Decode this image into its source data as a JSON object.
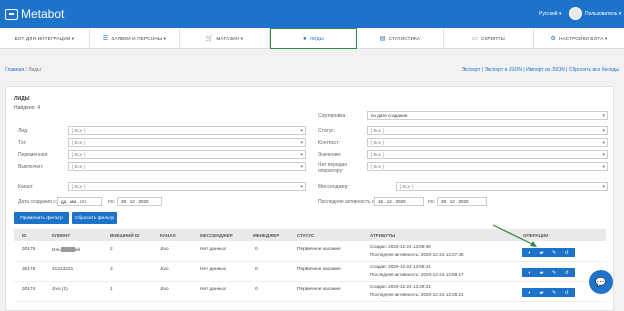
{
  "app": {
    "brand": "Metabot",
    "language": "Русский",
    "user": "Пользователь"
  },
  "nav": [
    {
      "label": "БОТ ДЛЯ ИНТЕГРАЦИИ",
      "icon": "chevron-down-icon"
    },
    {
      "label": "ЗАЯВКИ И ПЕРСОНЫ",
      "icon": "list-icon"
    },
    {
      "label": "МАГАЗИН",
      "icon": "cart-icon"
    },
    {
      "label": "ЛИДЫ",
      "icon": "person-icon"
    },
    {
      "label": "СТАТИСТИКА",
      "icon": "stats-icon"
    },
    {
      "label": "СКРИПТЫ",
      "icon": "script-icon"
    },
    {
      "label": "НАСТРОЙКИ БОТА",
      "icon": "gear-icon"
    }
  ],
  "breadcrumb": {
    "home": "Главная",
    "sep": "/",
    "current": "Лиды"
  },
  "top_links": "Экспорт | Экспорт в JSON | Импорт из JSON | Сбросить все беседы",
  "panel": {
    "title": "ЛИДЫ",
    "found": "Найдено: 4"
  },
  "filters": {
    "sort_label": "Сортировка:",
    "sort_value": "по дате создания",
    "lead": "Лид:",
    "tag": "Тэг:",
    "variable": "Переменная:",
    "off": "Выключен:",
    "status": "Статус:",
    "context": "Контекст:",
    "value": "Значение:",
    "operator": "Чат передан оператору:",
    "all": "[ Все ]",
    "channel": "Канал:",
    "messenger": "Мессенджер:",
    "created_label": "Дата создания с:",
    "created_from": "дд . мм . гггг",
    "created_to_label": "по:",
    "created_to": "28 . 12 . 2020",
    "activity_label": "Последняя активность с:",
    "activity_from": "16 . 12 . 2020",
    "activity_to_label": "по:",
    "activity_to": "28 . 12 . 2020"
  },
  "buttons": {
    "apply": "Применить фильтр",
    "reset": "Сбросить фильтр"
  },
  "table": {
    "headers": [
      "ID",
      "КЛИЕНТ",
      "ВНЕШНИЙ ID",
      "КАНАЛ",
      "МЕССЕНДЖЕР",
      "МЕНЕДЖЕР",
      "СТАТУС",
      "АТРИБУТЫ",
      "ОПЕРАЦИИ"
    ],
    "rows": [
      {
        "id": "30176",
        "client": "Иль",
        "client_tail": "ей",
        "ext": "2",
        "channel": "Jivo",
        "messenger": "Нет данных",
        "manager": "0",
        "status": "Первичное касание",
        "created": "Создан: 2020-12-24 13:59:48",
        "activity": "Последняя активность: 2020-12-24 14:27:45"
      },
      {
        "id": "30175",
        "client": "21213221",
        "ext": "3",
        "channel": "Jivo",
        "messenger": "Нет данных",
        "manager": "0",
        "status": "Первичное касание",
        "created": "Создан: 2020-12-24 13:58:41",
        "activity": "Последняя активность: 2020-12-24 13:59:17"
      },
      {
        "id": "30174",
        "client": "Jivo (1)",
        "ext": "1",
        "channel": "Jivo",
        "messenger": "Нет данных",
        "manager": "0",
        "status": "Первичное касание",
        "created": "Создан: 2020-12-24 13:28:21",
        "activity": "Последняя активность: 2020-12-24 13:28:21"
      }
    ]
  }
}
